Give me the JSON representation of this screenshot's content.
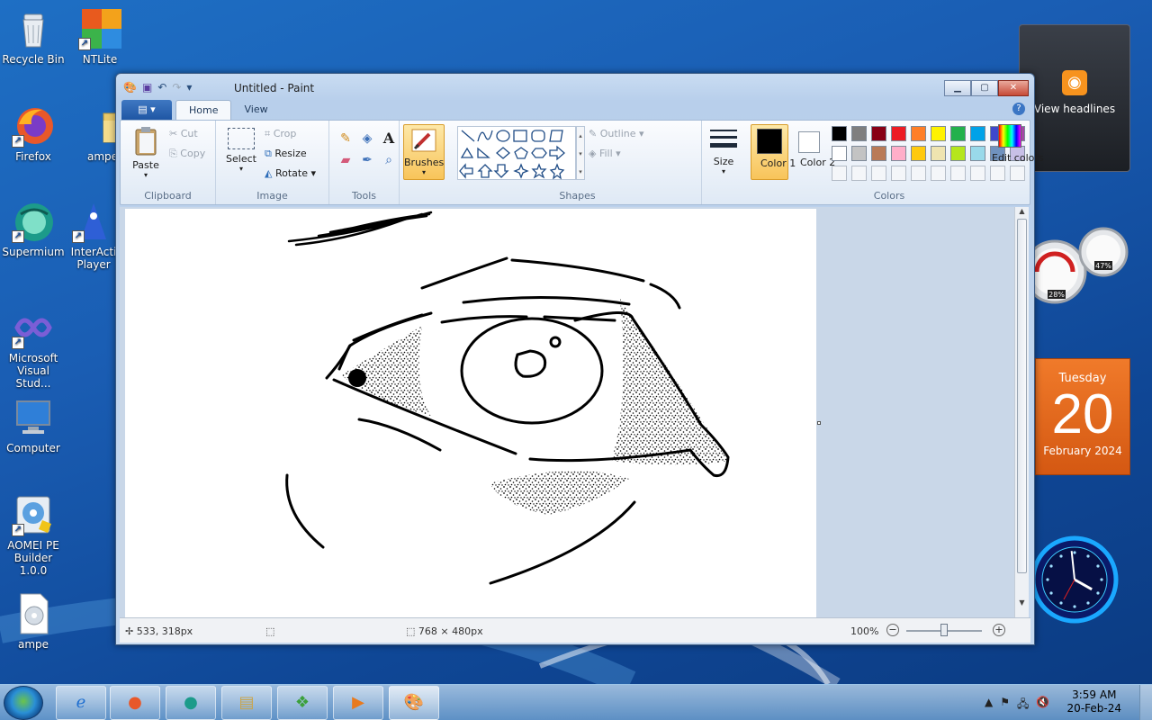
{
  "desktop": {
    "icons": [
      {
        "label": "Recycle Bin",
        "icon": "recycle-bin-icon"
      },
      {
        "label": "NTLite",
        "icon": "ntlite-icon"
      },
      {
        "label": "Firefox",
        "icon": "firefox-icon"
      },
      {
        "label": "ampe",
        "icon": "folder-icon"
      },
      {
        "label": "Supermium",
        "icon": "supermium-icon"
      },
      {
        "label": "InterActi Player",
        "icon": "interactive-player-icon"
      },
      {
        "label": "Microsoft Visual Stud...",
        "icon": "visual-studio-icon"
      },
      {
        "label": "Computer",
        "icon": "computer-icon"
      },
      {
        "label": "AOMEI PE Builder 1.0.0",
        "icon": "aomei-icon"
      },
      {
        "label": "ampe",
        "icon": "disc-file-icon"
      }
    ]
  },
  "gadgets": {
    "news": {
      "label": "View headlines"
    },
    "meter": {
      "cpu": "28%",
      "ram": "47%"
    },
    "calendar": {
      "weekday": "Tuesday",
      "day": "20",
      "month": "February 2024"
    },
    "clock": {
      "hour": 3,
      "minute": 59
    }
  },
  "window": {
    "title": "Untitled - Paint",
    "tabs": [
      "Home",
      "View"
    ],
    "ribbon": {
      "clipboard": {
        "label": "Clipboard",
        "paste": "Paste",
        "cut": "Cut",
        "copy": "Copy"
      },
      "image": {
        "label": "Image",
        "select": "Select",
        "crop": "Crop",
        "resize": "Resize",
        "rotate": "Rotate"
      },
      "tools": {
        "label": "Tools"
      },
      "brushes": {
        "label": "Brushes"
      },
      "shapes": {
        "label": "Shapes",
        "outline": "Outline",
        "fill": "Fill"
      },
      "size": {
        "label": "Size"
      },
      "colors": {
        "label": "Colors",
        "color1": "Color 1",
        "color2": "Color 2",
        "edit": "Edit colors",
        "color1_value": "#000000",
        "color2_value": "#ffffff",
        "palette_row1": [
          "#000000",
          "#7f7f7f",
          "#880015",
          "#ed1c24",
          "#ff7f27",
          "#fff200",
          "#22b14c",
          "#00a2e8",
          "#3f48cc",
          "#a349a4"
        ],
        "palette_row2": [
          "#ffffff",
          "#c3c3c3",
          "#b97a57",
          "#ffaec9",
          "#ffc90e",
          "#efe4b0",
          "#b5e61d",
          "#99d9ea",
          "#7092be",
          "#c8bfe7"
        ]
      }
    },
    "status": {
      "cursor": "533, 318px",
      "size": "768 × 480px",
      "zoom": "100%",
      "zoom_level_percent": 100
    }
  },
  "taskbar": {
    "items": [
      "ie-icon",
      "firefox-icon",
      "supermium-icon",
      "explorer-icon",
      "media-center-icon",
      "media-player-icon",
      "paint-icon"
    ],
    "time": "3:59 AM",
    "date": "20-Feb-24"
  }
}
